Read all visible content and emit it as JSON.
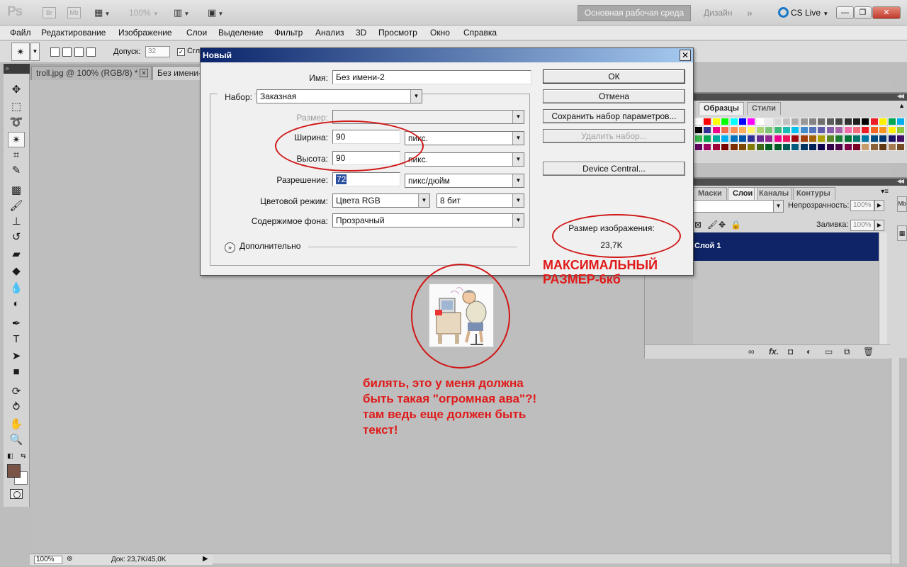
{
  "appbar": {
    "logo": "Ps",
    "bridge": "Br",
    "minibridge": "Mb",
    "zoom": "100%",
    "workspace_active": "Основная рабочая среда",
    "workspace_design": "Дизайн",
    "workspace_more": "»",
    "cs_live": "CS Live",
    "win_min": "—",
    "win_max": "❐",
    "win_close": "✕"
  },
  "menu": [
    "Файл",
    "Редактирование",
    "Изображение",
    "Слои",
    "Выделение",
    "Фильтр",
    "Анализ",
    "3D",
    "Просмотр",
    "Окно",
    "Справка"
  ],
  "options": {
    "tolerance_label": "Допуск:",
    "tolerance_value": "32",
    "antialias_label": "Сгл"
  },
  "tabs": {
    "troll": "troll.jpg @ 100% (RGB/8) *",
    "untitled": "Без имени-"
  },
  "statusbar": {
    "zoom": "100%",
    "doc": "Док: 23,7K/45,0K"
  },
  "panels": {
    "swatches_tab": "Образцы",
    "styles_tab": "Стили",
    "masks_tab": "Маски",
    "layers_tab": "Слои",
    "channels_tab": "Каналы",
    "paths_tab": "Контуры",
    "opacity_label": "Непрозрачность:",
    "opacity_value": "100%",
    "fill_label": "Заливка:",
    "fill_value": "100%",
    "layer_name": "Слой 1",
    "fx": "fx.",
    "side_tab": "Mb"
  },
  "swatches": [
    "#ffffff",
    "#ff0000",
    "#ffff00",
    "#00ff00",
    "#00ffff",
    "#0000ff",
    "#ff00ff",
    "#ffffff",
    "#ebebeb",
    "#d6d6d6",
    "#c2c2c2",
    "#adadad",
    "#999999",
    "#858585",
    "#707070",
    "#5c5c5c",
    "#474747",
    "#333333",
    "#1f1f1f",
    "#000000",
    "#ed1c24",
    "#fff200",
    "#00a651",
    "#00aeef",
    "#000000",
    "#2e3192",
    "#ec008c",
    "#f26c4f",
    "#f68e56",
    "#fbaf5d",
    "#fff568",
    "#acd373",
    "#7cc576",
    "#3bb878",
    "#1abbb4",
    "#00bff3",
    "#438ccb",
    "#5574b9",
    "#605ca8",
    "#855fa8",
    "#a763a9",
    "#f06ea9",
    "#f26d7d",
    "#ed1c24",
    "#f26522",
    "#f7941d",
    "#fff200",
    "#8dc63f",
    "#39b54a",
    "#00a651",
    "#00a99d",
    "#00aeef",
    "#0072bc",
    "#0054a6",
    "#2e3192",
    "#662d91",
    "#92278f",
    "#ec008c",
    "#ed145b",
    "#9e0b0f",
    "#a0410d",
    "#a36209",
    "#aba000",
    "#598527",
    "#197b30",
    "#007236",
    "#00746b",
    "#0076a3",
    "#004a80",
    "#003471",
    "#1b1464",
    "#440e62",
    "#630460",
    "#9e005d",
    "#9e0039",
    "#790000",
    "#7b2e00",
    "#7d4900",
    "#827b00",
    "#406618",
    "#005e20",
    "#005826",
    "#005952",
    "#005b7f",
    "#003663",
    "#002157",
    "#0d004c",
    "#32004b",
    "#4b0049",
    "#7b0046",
    "#7a0026",
    "#c69c6d",
    "#8c6239",
    "#603913",
    "#a67c52",
    "#754c24"
  ],
  "dialog": {
    "title": "Новый",
    "close": "✕",
    "name_label": "Имя:",
    "name_value": "Без имени-2",
    "preset_label": "Набор:",
    "preset_value": "Заказная",
    "size_label": "Размер:",
    "width_label": "Ширина:",
    "width_value": "90",
    "width_unit": "пикс.",
    "height_label": "Высота:",
    "height_value": "90",
    "height_unit": "пикс.",
    "resolution_label": "Разрешение:",
    "resolution_value": "72",
    "resolution_unit": "пикс/дюйм",
    "color_mode_label": "Цветовой режим:",
    "color_mode_value": "Цвета RGB",
    "bit_depth": "8 бит",
    "background_label": "Содержимое фона:",
    "background_value": "Прозрачный",
    "advanced": "Дополнительно",
    "ok": "ОК",
    "cancel": "Отмена",
    "save_preset": "Сохранить набор параметров...",
    "delete_preset": "Удалить набор...",
    "device_central": "Device Central...",
    "image_size_label": "Размер изображения:",
    "image_size_value": "23,7K"
  },
  "annotations": {
    "max_size_line1": "МАКСИМАЛЬНЫЙ",
    "max_size_line2": "РАЗМЕР-6кб",
    "comment_line1": "билять, это у меня должна",
    "comment_line2": "быть такая \"огромная ава\"?!",
    "comment_line3": "там ведь еще должен быть",
    "comment_line4": "текст!",
    "color": "#e01a1a"
  }
}
